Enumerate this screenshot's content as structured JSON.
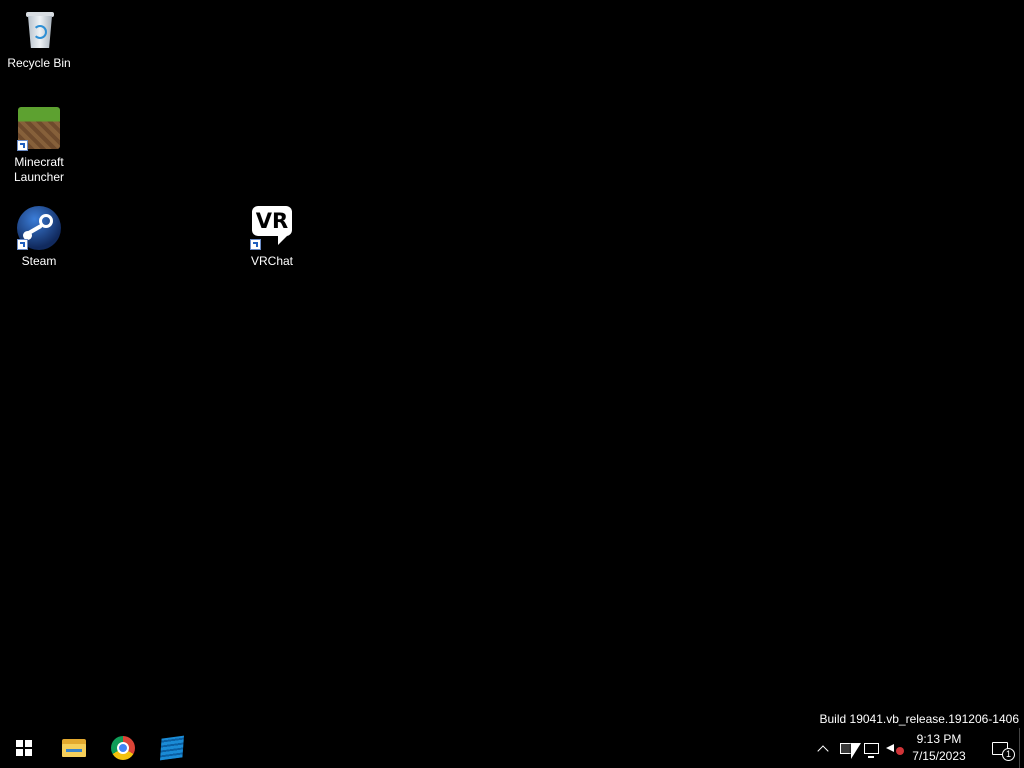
{
  "desktop": {
    "icons": [
      {
        "label": "Recycle Bin",
        "icon": "recycle-bin-icon"
      },
      {
        "label": "Minecraft Launcher",
        "icon": "minecraft-icon"
      },
      {
        "label": "Steam",
        "icon": "steam-icon"
      },
      {
        "label": "VRChat",
        "icon": "vrchat-icon",
        "glyph": "VR"
      }
    ],
    "watermark": "Build 19041.vb_release.191206-1406"
  },
  "taskbar": {
    "start": {
      "icon": "windows-logo-icon"
    },
    "pinned": [
      {
        "icon": "file-explorer-icon"
      },
      {
        "icon": "chrome-icon"
      },
      {
        "icon": "roblox-studio-icon"
      }
    ],
    "tray": {
      "icons": [
        "chevron-up-icon",
        "tray-app-icon",
        "network-icon",
        "speaker-muted-icon"
      ],
      "time": "9:13 PM",
      "date": "7/15/2023",
      "notification_count": "1"
    }
  },
  "colors": {
    "desktop_background": "#000000",
    "taskbar_background": "#000000",
    "text": "#ffffff"
  }
}
